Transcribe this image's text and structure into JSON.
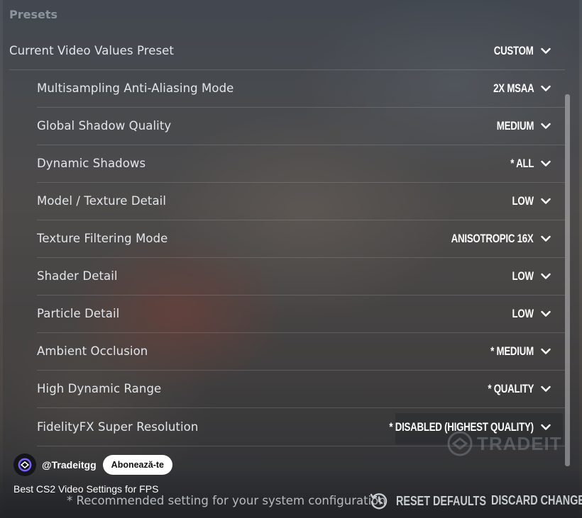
{
  "section": {
    "title": "Presets"
  },
  "preset": {
    "label": "Current Video Values Preset",
    "value": "CUSTOM"
  },
  "settings": [
    {
      "label": "Multisampling Anti-Aliasing Mode",
      "value": "2X MSAA"
    },
    {
      "label": "Global Shadow Quality",
      "value": "MEDIUM"
    },
    {
      "label": "Dynamic Shadows",
      "value": "* ALL"
    },
    {
      "label": "Model / Texture Detail",
      "value": "LOW"
    },
    {
      "label": "Texture Filtering Mode",
      "value": "ANISOTROPIC 16X"
    },
    {
      "label": "Shader Detail",
      "value": "LOW"
    },
    {
      "label": "Particle Detail",
      "value": "LOW"
    },
    {
      "label": "Ambient Occlusion",
      "value": "* MEDIUM"
    },
    {
      "label": "High Dynamic Range",
      "value": "* QUALITY"
    },
    {
      "label": "FidelityFX Super Resolution",
      "value": "* DISABLED (HIGHEST QUALITY)"
    }
  ],
  "footer": {
    "note": "* Recommended setting for your system configuration",
    "reset_label": "RESET DEFAULTS",
    "discard_label": "DISCARD CHANGES"
  },
  "overlay": {
    "channel": "@Tradeitgg",
    "subscribe": "Abonează-te",
    "video_title": "Best CS2 Video Settings for FPS",
    "watermark": "TRADEIT"
  },
  "colors": {
    "label": "#e3e6ea",
    "value": "#ffffff",
    "divider": "#d2d7dc"
  },
  "icons": {
    "dropdown": "chevron-down-icon",
    "reset": "history-icon"
  }
}
